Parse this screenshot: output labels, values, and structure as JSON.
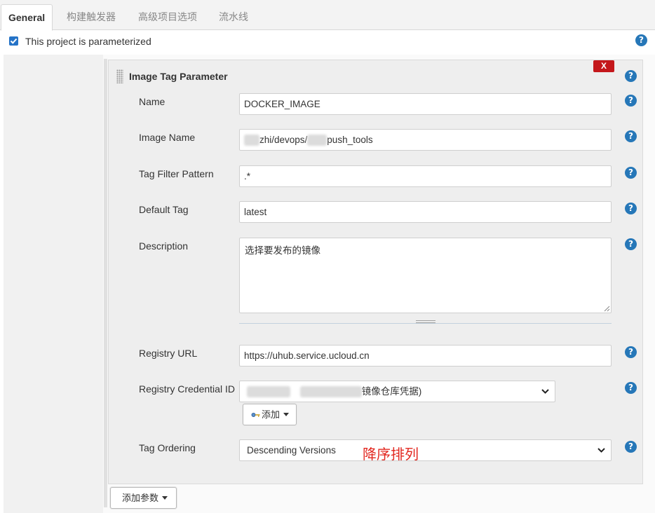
{
  "tabs": [
    {
      "label": "General"
    },
    {
      "label": "构建触发器"
    },
    {
      "label": "高级项目选项"
    },
    {
      "label": "流水线"
    }
  ],
  "parameterized": {
    "label": "This project is parameterized",
    "checked": true
  },
  "help_glyph": "?",
  "param": {
    "title": "Image Tag Parameter",
    "close_label": "X",
    "fields": {
      "name": {
        "label": "Name",
        "value": "DOCKER_IMAGE"
      },
      "image_name": {
        "label": "Image Name",
        "value_part1": "zhi/devops/",
        "value_part2": "push_tools"
      },
      "tag_filter": {
        "label": "Tag Filter Pattern",
        "value": ".*"
      },
      "default_tag": {
        "label": "Default Tag",
        "value": "latest"
      },
      "description": {
        "label": "Description",
        "value": "选择要发布的镜像"
      },
      "registry_url": {
        "label": "Registry URL",
        "value": "https://uhub.service.ucloud.cn"
      },
      "credential": {
        "label": "Registry Credential ID",
        "value_visible": "镜像仓库凭据)",
        "add_label": "添加"
      },
      "tag_ordering": {
        "label": "Tag Ordering",
        "value": "Descending Versions",
        "annotation": "降序排列"
      }
    }
  },
  "add_param_label": "添加参数",
  "colors": {
    "accent": "#2677b8",
    "close": "#c4171b",
    "annotation": "#e2261e"
  }
}
